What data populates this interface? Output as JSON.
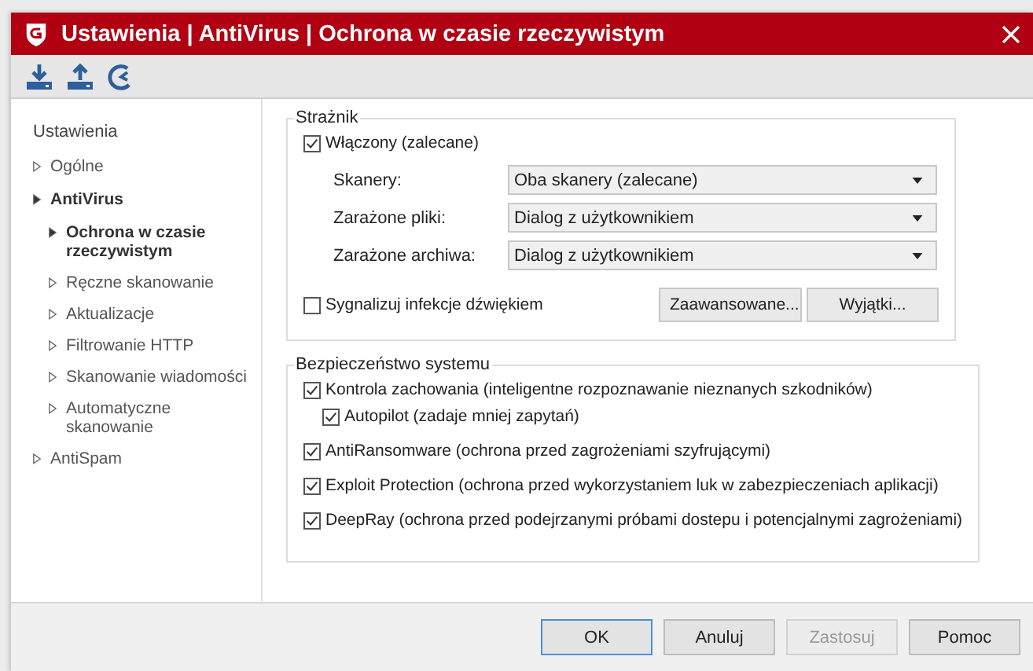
{
  "window": {
    "title": "Ustawienia | AntiVirus | Ochrona w czasie rzeczywistym"
  },
  "sidebar": {
    "heading": "Ustawienia",
    "items": [
      {
        "label": "Ogólne",
        "expanded": false
      },
      {
        "label": "AntiVirus",
        "expanded": true,
        "children": [
          {
            "label": "Ochrona w czasie rzeczywistym",
            "selected": true
          },
          {
            "label": "Ręczne skanowanie",
            "selected": false
          },
          {
            "label": "Aktualizacje",
            "selected": false
          },
          {
            "label": "Filtrowanie HTTP",
            "selected": false
          },
          {
            "label": "Skanowanie wiadomości",
            "selected": false
          },
          {
            "label": "Automatyczne skanowanie",
            "selected": false
          }
        ]
      },
      {
        "label": "AntiSpam",
        "expanded": false
      }
    ]
  },
  "guard": {
    "title": "Strażnik",
    "enabled": {
      "label": "Włączony (zalecane)",
      "checked": true
    },
    "selects": [
      {
        "label": "Skanery:",
        "value": "Oba skanery (zalecane)"
      },
      {
        "label": "Zarażone pliki:",
        "value": "Dialog z użytkownikiem"
      },
      {
        "label": "Zarażone archiwa:",
        "value": "Dialog z użytkownikiem"
      }
    ],
    "sound": {
      "label": "Sygnalizuj infekcje dźwiękiem",
      "checked": false
    },
    "buttons": [
      "Zaawansowane...",
      "Wyjątki..."
    ]
  },
  "system": {
    "title": "Bezpieczeństwo systemu",
    "options": [
      {
        "label": "Kontrola zachowania (inteligentne rozpoznawanie nieznanych szkodników)",
        "checked": true,
        "children": [
          {
            "label": "Autopilot (zadaje mniej zapytań)",
            "checked": true
          }
        ]
      },
      {
        "label": "AntiRansomware (ochrona przed zagrożeniami szyfrującymi)",
        "checked": true
      },
      {
        "label": "Exploit Protection (ochrona przed wykorzystaniem luk w zabezpieczeniach aplikacji)",
        "checked": true
      },
      {
        "label": "DeepRay (ochrona przed podejrzanymi próbami dostepu i potencjalnymi zagrożeniami)",
        "checked": true
      }
    ]
  },
  "footer_buttons": [
    {
      "label": "OK",
      "kind": "default",
      "disabled": false
    },
    {
      "label": "Anuluj",
      "kind": "normal",
      "disabled": false
    },
    {
      "label": "Zastosuj",
      "kind": "normal",
      "disabled": true
    },
    {
      "label": "Pomoc",
      "kind": "normal",
      "disabled": false
    }
  ]
}
